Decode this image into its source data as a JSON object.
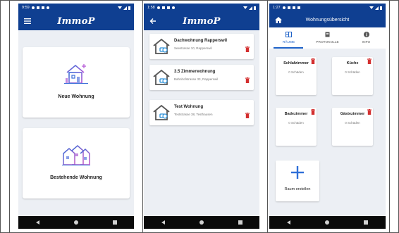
{
  "colors": {
    "primary": "#0f3f91",
    "accent": "#1e62c8",
    "delete": "#d32f2f",
    "background": "#eceff4"
  },
  "phones": [
    {
      "status": {
        "time": "9:59"
      },
      "appbar": {
        "brand": "ImmoP",
        "lead_icon": "menu-icon"
      },
      "cards": [
        {
          "label": "Neue Wohnung",
          "icon": "new-house-icon"
        },
        {
          "label": "Bestehende Wohnung",
          "icon": "existing-houses-icon"
        }
      ]
    },
    {
      "status": {
        "time": "1:58"
      },
      "appbar": {
        "brand": "ImmoP",
        "lead_icon": "back-arrow-icon"
      },
      "apartments": [
        {
          "name": "Dachwohnung Rapperswil",
          "address": "Seestrasse 10, Rapperswil"
        },
        {
          "name": "3.5 Zimmerwohnung",
          "address": "Bahnhofstrasse 33, Rapperswil"
        },
        {
          "name": "Test Wohnung",
          "address": "Teststrasse 38, Testhausen"
        }
      ]
    },
    {
      "status": {
        "time": "1:27"
      },
      "appbar": {
        "title": "Wohnungsübersicht",
        "lead_icon": "home-icon"
      },
      "tabs": [
        {
          "label": "RÄUME",
          "icon": "rooms-icon",
          "active": true
        },
        {
          "label": "PROTOKOLLE",
          "icon": "protocol-icon",
          "active": false
        },
        {
          "label": "INFO",
          "icon": "info-icon",
          "active": false
        }
      ],
      "rooms": [
        {
          "name": "Schlafzimmer",
          "damage": "0 Schäden"
        },
        {
          "name": "Küche",
          "damage": "0 Schäden"
        },
        {
          "name": "Badezimmer",
          "damage": "0 Schäden"
        },
        {
          "name": "Gästezimmer",
          "damage": "0 Schäden"
        }
      ],
      "add_room_label": "Raum erstellen"
    }
  ]
}
